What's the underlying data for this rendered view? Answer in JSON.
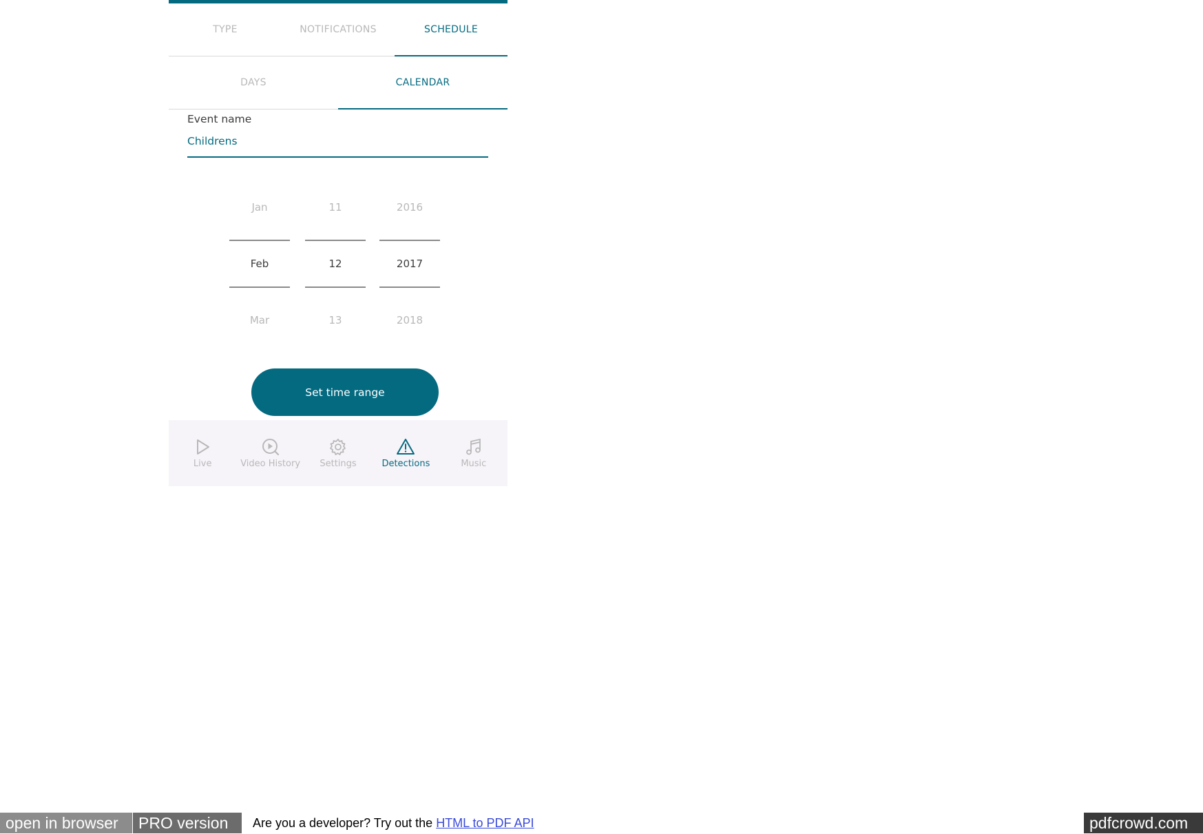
{
  "colors": {
    "accent": "#046a80",
    "inactive": "#b8b8b8",
    "nav_bg": "#f7f4f9"
  },
  "tabs": [
    {
      "label": "TYPE",
      "active": false
    },
    {
      "label": "NOTIFICATIONS",
      "active": false
    },
    {
      "label": "SCHEDULE",
      "active": true
    }
  ],
  "subtabs": [
    {
      "label": "DAYS",
      "active": false
    },
    {
      "label": "CALENDAR",
      "active": true
    }
  ],
  "event": {
    "label": "Event name",
    "value": "Childrens"
  },
  "date_picker": {
    "month": {
      "prev": "Jan",
      "selected": "Feb",
      "next": "Mar"
    },
    "day": {
      "prev": "11",
      "selected": "12",
      "next": "13"
    },
    "year": {
      "prev": "2016",
      "selected": "2017",
      "next": "2018"
    }
  },
  "set_button": {
    "label": "Set time range"
  },
  "bottom_nav": [
    {
      "label": "Live",
      "icon": "play-icon",
      "active": false
    },
    {
      "label": "Video History",
      "icon": "video-history-icon",
      "active": false
    },
    {
      "label": "Settings",
      "icon": "gear-icon",
      "active": false
    },
    {
      "label": "Detections",
      "icon": "warning-icon",
      "active": true
    },
    {
      "label": "Music",
      "icon": "music-note-icon",
      "active": false
    }
  ],
  "footer": {
    "open_in_browser": "open in browser",
    "pro_version": "PRO version",
    "dev_text": "Are you a developer? Try out the",
    "api_link": "HTML to PDF API",
    "brand": "pdfcrowd.com"
  }
}
